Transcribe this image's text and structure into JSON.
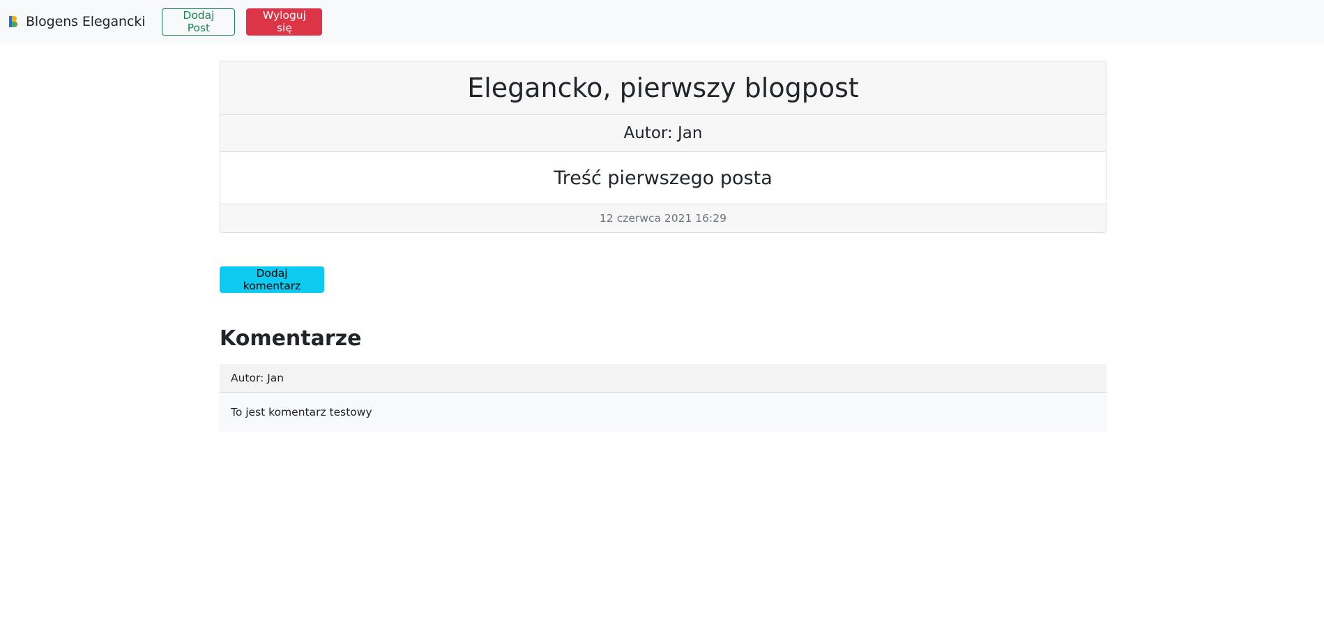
{
  "navbar": {
    "brand": "Blogens Elegancki",
    "add_post_label": "Dodaj Post",
    "logout_label": "Wyloguj się"
  },
  "post": {
    "title": "Elegancko, pierwszy blogpost",
    "author": "Autor: Jan",
    "content": "Treść pierwszego posta",
    "date": "12 czerwca 2021 16:29"
  },
  "add_comment_label": "Dodaj komentarz",
  "comments": {
    "heading": "Komentarze",
    "items": [
      {
        "author": "Autor: Jan",
        "text": "To jest komentarz testowy"
      }
    ]
  },
  "colors": {
    "navbar_bg": "#f8f9fa",
    "success": "#198754",
    "danger": "#dc3545",
    "info": "#0dcaf0"
  }
}
